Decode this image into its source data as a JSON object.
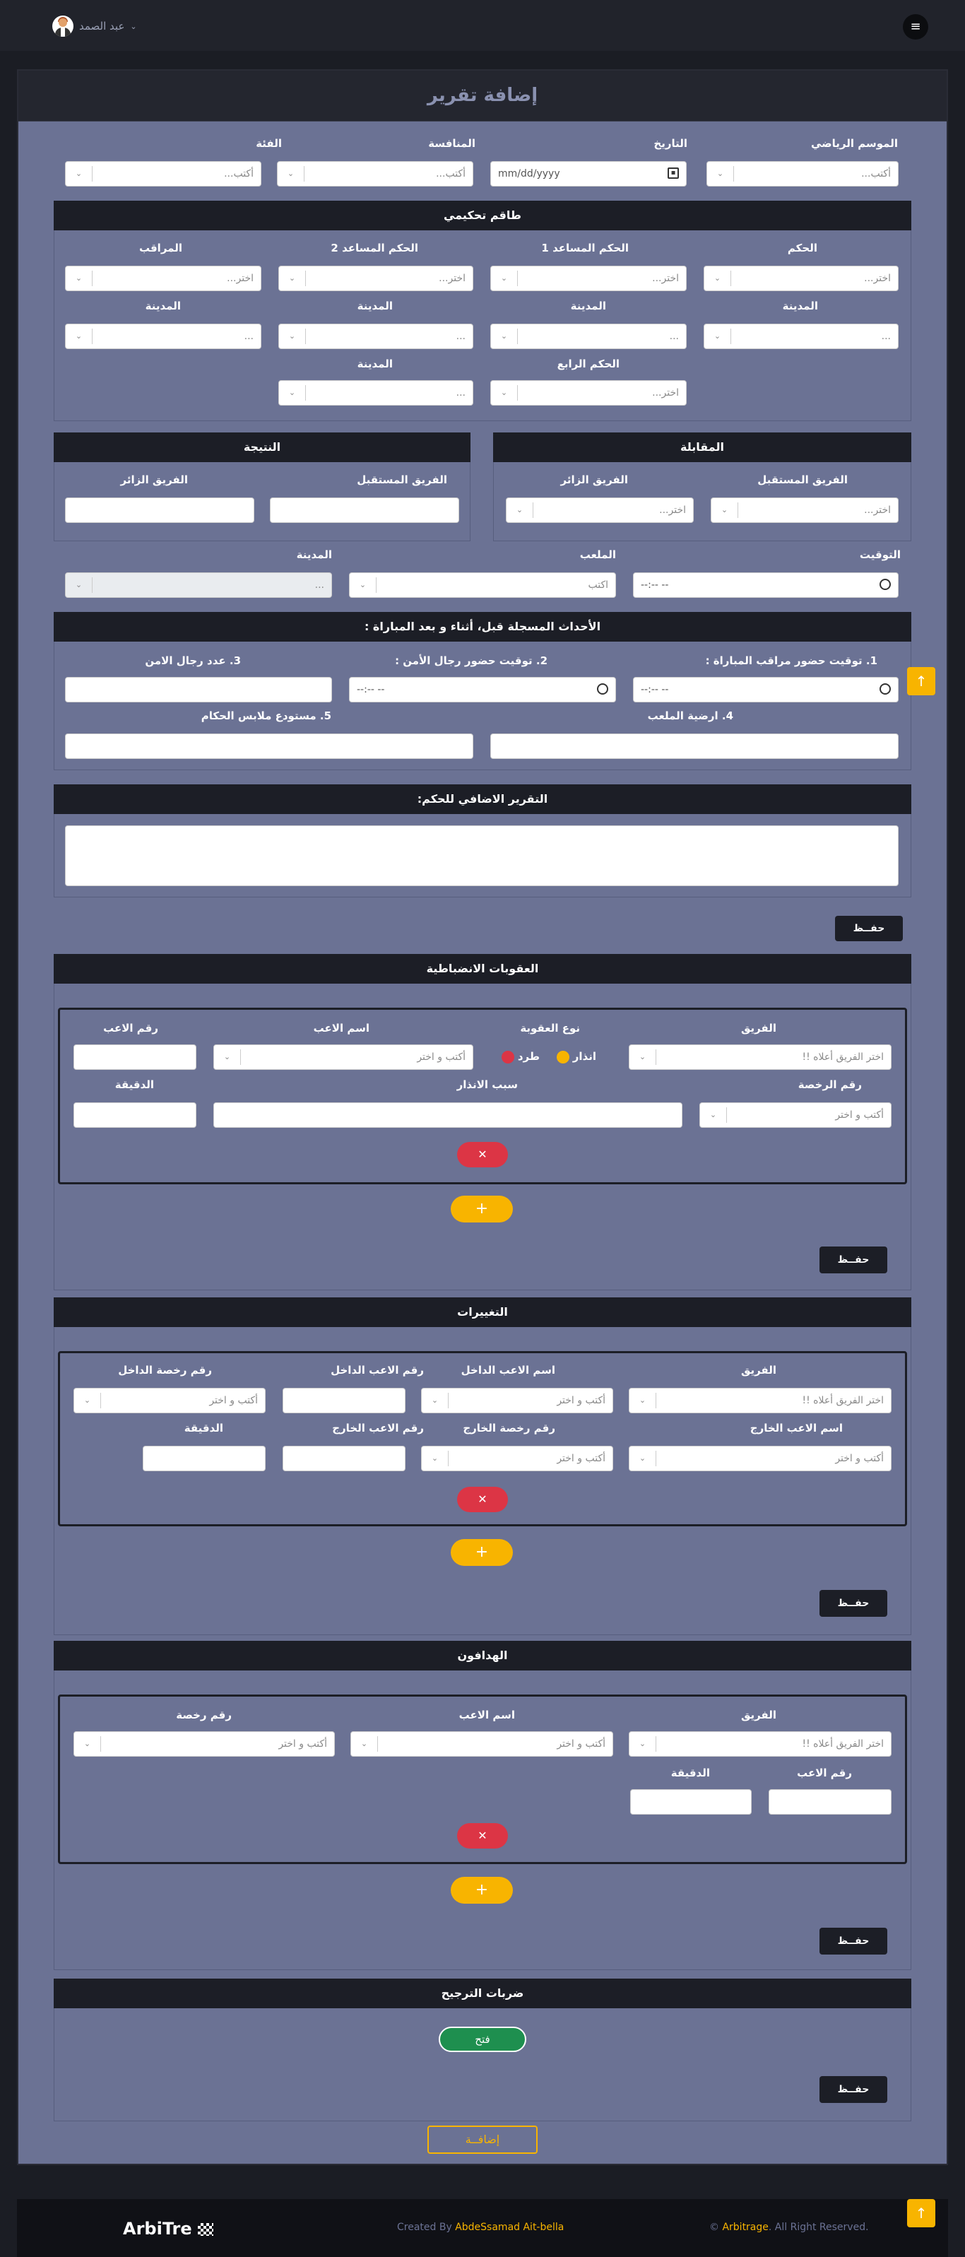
{
  "nav": {
    "menu_icon": "≡",
    "user_name": "عبد الصمد",
    "chevron": "⌄"
  },
  "page": {
    "title": "إضافة تقرير"
  },
  "main_fields": {
    "season_label": "الموسم الرياضي",
    "season_ph": "أكتب...",
    "date_label": "التاريخ",
    "date_ph": "mm/dd/yyyy",
    "competition_label": "المنافسة",
    "competition_ph": "أكتب...",
    "category_label": "الفئة",
    "category_ph": "أكتب..."
  },
  "referee_team": {
    "title": "طاقم تحكيمي",
    "ref_label": "الحكم",
    "ast1_label": "الحكم المساعد 1",
    "ast2_label": "الحكم المساعد 2",
    "observer_label": "المراقب",
    "fourth_label": "الحكم الرابع",
    "city_label": "المدينة",
    "choose_ph": "اختر...",
    "city_ph": "..."
  },
  "match": {
    "title": "المقابلة",
    "home_label": "الفريق المستقبل",
    "away_label": "الفريق الزائر",
    "choose_ph": "اختر..."
  },
  "result": {
    "title": "النتيجة",
    "home_label": "الفريق المستقبل",
    "away_label": "الفريق الزائر"
  },
  "venue": {
    "time_label": "التوقيت",
    "time_ph": "--:-- --",
    "stadium_label": "الملعب",
    "stadium_ph": "اكتب",
    "city_label": "المدينة",
    "city_ph": "..."
  },
  "events": {
    "title": "الأحداث المسجلة قبل، أثناء و بعد المباراة :",
    "q1": "1. توقيت حضور مراقب المباراة :",
    "q2": "2. توقيت حضور رجال الأمن :",
    "q3": "3. عدد رجال الامن",
    "q4": "4. ارضية الملعب",
    "q5": "5. مستودع ملابس الحكام",
    "time_ph": "--:-- --"
  },
  "extra_report": {
    "title": "التقرير الاضافي للحكم:"
  },
  "save_label": "حفــظ",
  "discipline": {
    "title": "العقوبات الانضباطية",
    "team_label": "الفريق",
    "team_ph": "اختر الفريق أعلاه !!",
    "type_label": "نوع العقوبة",
    "warn_label": "انذار",
    "expel_label": "طرد",
    "player_name_label": "اسم الاعب",
    "player_name_ph": "أكتب و اختر",
    "player_num_label": "رقم الاعب",
    "license_label": "رقم الرخصة",
    "license_ph": "أكتب و اختر",
    "reason_label": "سبب الانذار",
    "minute_label": "الدقيقة"
  },
  "subs": {
    "title": "التغييرات",
    "team_label": "الفريق",
    "team_ph": "اختر الفريق أعلاه !!",
    "in_name_label": "اسم الاعب الداخل",
    "in_name_ph": "أكتب و اختر",
    "in_num_label": "رقم الاعب الداخل",
    "in_license_label": "رقم رخصة الداخل",
    "in_license_ph": "أكتب و اختر",
    "out_name_label": "اسم الاعب الخارج",
    "out_name_ph": "أكتب و اختر",
    "out_license_label": "رقم رخصة الخارج",
    "out_license_ph": "أكتب و اختر",
    "out_num_label": "رقم الاعب الخارج",
    "minute_label": "الدقيقة"
  },
  "scorers": {
    "title": "الهدافون",
    "team_label": "الفريق",
    "team_ph": "اختر الفريق أعلاه !!",
    "player_name_label": "اسم الاعب",
    "player_name_ph": "أكتب و اختر",
    "license_label": "رقم رخصة",
    "license_ph": "أكتب و اختر",
    "player_num_label": "رقم الاعب",
    "minute_label": "الدقيقة"
  },
  "penalties": {
    "title": "ضربات الترجيح",
    "open_label": "فتح"
  },
  "icons": {
    "remove": "✕",
    "add": "+",
    "up": "↑"
  },
  "submit_label": "إضافــة",
  "footer": {
    "brand": "ArbiTre",
    "created_prefix": "Created By",
    "author": "AbdeSsamad Ait-bella",
    "copy_symbol": "©",
    "site": "Arbitrage",
    "rights": ". All Right Reserved."
  },
  "colors": {
    "accent": "#f8b400",
    "panel": "#6b7294",
    "dark": "#1c1e26",
    "danger": "#dc3545",
    "success": "#1e8f4f"
  }
}
